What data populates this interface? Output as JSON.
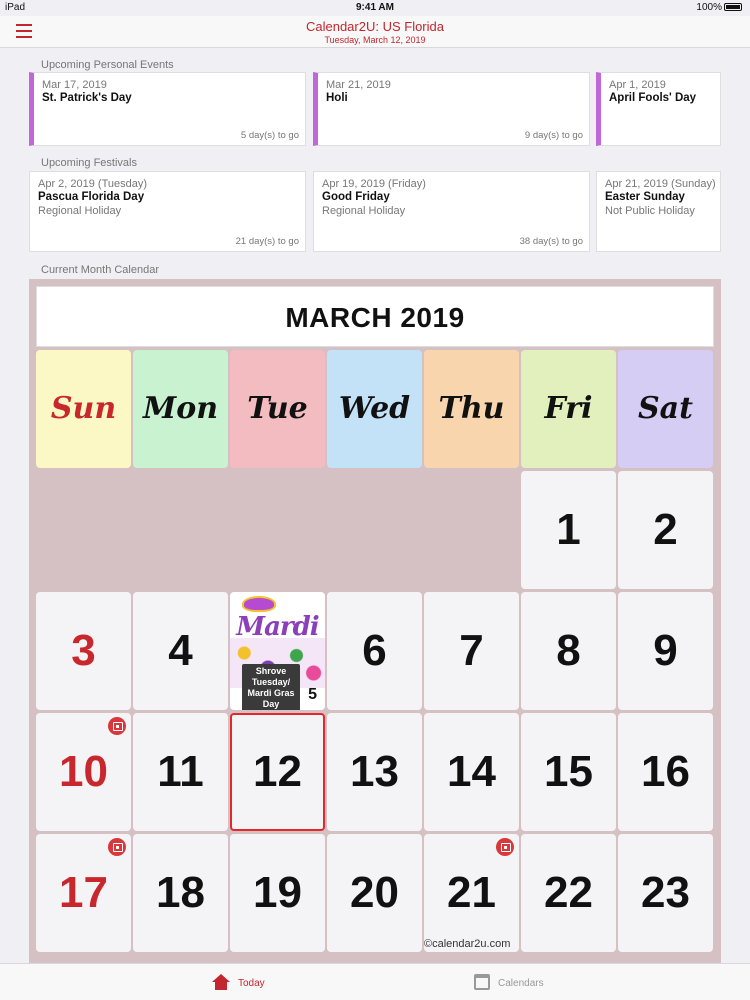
{
  "status_bar": {
    "device": "iPad",
    "time": "9:41 AM",
    "battery": "100%"
  },
  "navbar": {
    "title": "Calendar2U: US Florida",
    "subtitle": "Tuesday, March 12, 2019"
  },
  "personal_events": {
    "label": "Upcoming Personal Events",
    "items": [
      {
        "date": "Mar 17, 2019",
        "name": "St. Patrick's Day",
        "togo": "5 day(s) to go"
      },
      {
        "date": "Mar 21, 2019",
        "name": "Holi",
        "togo": "9 day(s) to go"
      },
      {
        "date": "Apr 1, 2019",
        "name": "April Fools' Day",
        "togo": ""
      }
    ]
  },
  "festivals": {
    "label": "Upcoming Festivals",
    "items": [
      {
        "date": "Apr 2, 2019 (Tuesday)",
        "name": "Pascua Florida Day",
        "type": "Regional Holiday",
        "togo": "21 day(s) to go"
      },
      {
        "date": "Apr 19, 2019 (Friday)",
        "name": "Good Friday",
        "type": "Regional Holiday",
        "togo": "38 day(s) to go"
      },
      {
        "date": "Apr 21, 2019 (Sunday)",
        "name": "Easter Sunday",
        "type": "Not Public Holiday",
        "togo": ""
      }
    ]
  },
  "calendar": {
    "section_label": "Current Month Calendar",
    "month_title": "MARCH 2019",
    "weekdays": [
      {
        "label": "Sun",
        "color": "#fbf8c6",
        "text_color": "#c8282d"
      },
      {
        "label": "Mon",
        "color": "#c9f2d1"
      },
      {
        "label": "Tue",
        "color": "#f2bcc0"
      },
      {
        "label": "Wed",
        "color": "#c3e1f7"
      },
      {
        "label": "Thu",
        "color": "#f8d5ad"
      },
      {
        "label": "Fri",
        "color": "#e2f0bd"
      },
      {
        "label": "Sat",
        "color": "#d5cdf4"
      }
    ],
    "days": [
      {
        "n": "1"
      },
      {
        "n": "2"
      },
      {
        "n": "3"
      },
      {
        "n": "4"
      },
      {
        "n": "5"
      },
      {
        "n": "6"
      },
      {
        "n": "7"
      },
      {
        "n": "8"
      },
      {
        "n": "9"
      },
      {
        "n": "10"
      },
      {
        "n": "11"
      },
      {
        "n": "12"
      },
      {
        "n": "13"
      },
      {
        "n": "14"
      },
      {
        "n": "15"
      },
      {
        "n": "16"
      },
      {
        "n": "17"
      },
      {
        "n": "18"
      },
      {
        "n": "19"
      },
      {
        "n": "20"
      },
      {
        "n": "21"
      },
      {
        "n": "22"
      },
      {
        "n": "23"
      }
    ],
    "today_day": "12",
    "event_icon_days": [
      "10",
      "17",
      "21"
    ],
    "featured_event": {
      "day": "5",
      "image_text": "Mardi",
      "label": "Shrove Tuesday/ Mardi Gras Day"
    },
    "watermark": "©calendar2u.com"
  },
  "tabbar": {
    "today_label": "Today",
    "calendars_label": "Calendars"
  },
  "colors": {
    "accent": "#c2262e",
    "personal_bar": "#c067d9",
    "calendar_bg": "#d5c0c3"
  }
}
